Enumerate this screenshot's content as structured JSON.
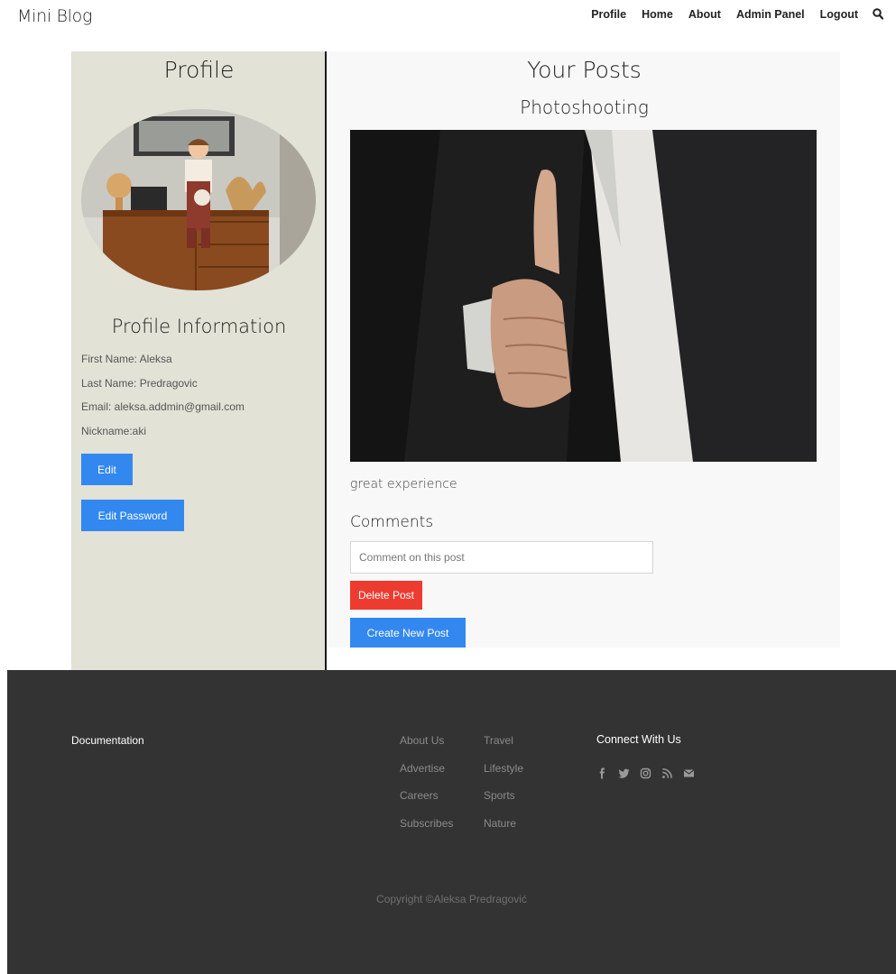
{
  "header": {
    "brand": "Mini Blog",
    "nav": [
      "Profile",
      "Home",
      "About",
      "Admin Panel",
      "Logout"
    ],
    "search_icon": "search-icon"
  },
  "profile": {
    "title": "Profile",
    "info_title": "Profile Information",
    "first_name": "First Name: Aleksa",
    "last_name": "Last Name: Predragovic",
    "email": "Email: aleksa.addmin@gmail.com",
    "nickname": "Nickname:aki",
    "edit_label": "Edit",
    "edit_password_label": "Edit Password"
  },
  "posts": {
    "title": "Your Posts",
    "post_title": "Photoshooting",
    "post_body": "great experience",
    "comments_title": "Comments",
    "comment_placeholder": "Comment on this post",
    "delete_label": "Delete Post",
    "create_label": "Create New Post"
  },
  "footer": {
    "documentation": "Documentation",
    "col1": [
      "About Us",
      "Advertise",
      "Careers",
      "Subscribes"
    ],
    "col2": [
      "Travel",
      "Lifestyle",
      "Sports",
      "Nature"
    ],
    "connect_title": "Connect With Us",
    "social_icons": [
      "facebook-icon",
      "twitter-icon",
      "instagram-icon",
      "rss-icon",
      "envelope-icon"
    ],
    "copyright": "Copyright ©Aleksa Predragović"
  },
  "colors": {
    "accent_blue": "#3388f0",
    "danger_red": "#ee3b30",
    "profile_bg": "#e2e2d7",
    "footer_bg": "#333333"
  }
}
